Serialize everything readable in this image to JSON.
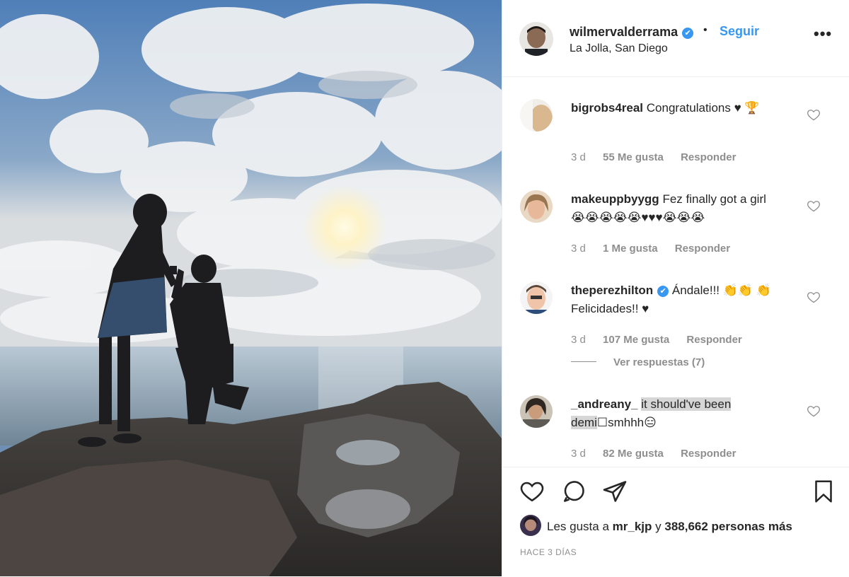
{
  "header": {
    "username": "wilmervalderrama",
    "verified_icon": "✔",
    "separator": "•",
    "follow_label": "Seguir",
    "location": "La Jolla, San Diego",
    "more_icon": "•••"
  },
  "comments": [
    {
      "user": "bigrobs4real",
      "text": "Congratulations ♥ 🏆",
      "age": "3 d",
      "likes": "55 Me gusta",
      "reply": "Responder"
    },
    {
      "user": "makeuppbyygg",
      "text": "Fez finally got a girl 😭😭😭😭😭♥♥♥😭😭😭",
      "age": "3 d",
      "likes": "1 Me gusta",
      "reply": "Responder"
    },
    {
      "user": "theperezhilton",
      "text_plain": "Ándale!!! 👏👏 👏 Felicidades!! ♥",
      "age": "3 d",
      "likes": "107 Me gusta",
      "reply": "Responder",
      "view_replies": "Ver respuestas (7)"
    },
    {
      "user": "_andreany_",
      "text_highlighted": "it should've been demi",
      "text_rest": "☐smhhh😑",
      "age": "3 d",
      "likes": "82 Me gusta",
      "reply": "Responder"
    }
  ],
  "actions": {
    "liked_by_prefix": "Les gusta a",
    "liked_by_user": "mr_kjp",
    "liked_by_suffix": "y",
    "liked_by_count": "388,662 personas más",
    "time_ago": "HACE 3 DÍAS"
  },
  "colors": {
    "link_blue": "#3897f0",
    "text_dark": "#262626",
    "text_muted": "#8e8e8e",
    "divider": "#efefef"
  },
  "icons": [
    "heart-icon",
    "comment-icon",
    "share-icon",
    "bookmark-icon",
    "verified-badge-icon",
    "more-options-icon"
  ]
}
